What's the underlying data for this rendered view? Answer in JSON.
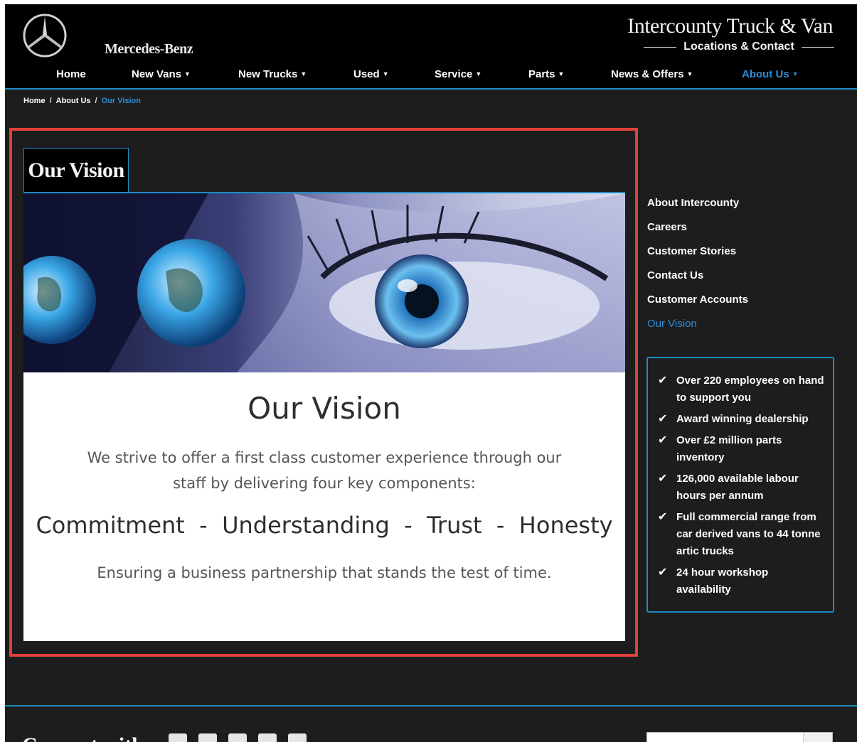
{
  "header": {
    "brand_name": "Mercedes-Benz",
    "dealer_title": "Intercounty Truck & Van",
    "locations_link": "Locations & Contact"
  },
  "nav": {
    "items": [
      {
        "label": "Home",
        "has_dropdown": false
      },
      {
        "label": "New Vans",
        "has_dropdown": true
      },
      {
        "label": "New Trucks",
        "has_dropdown": true
      },
      {
        "label": "Used",
        "has_dropdown": true
      },
      {
        "label": "Service",
        "has_dropdown": true
      },
      {
        "label": "Parts",
        "has_dropdown": true
      },
      {
        "label": "News & Offers",
        "has_dropdown": true
      },
      {
        "label": "About Us",
        "has_dropdown": true,
        "active": true
      }
    ],
    "caret": "▼"
  },
  "breadcrumb": {
    "items": [
      "Home",
      "About Us",
      "Our Vision"
    ],
    "separator": "/"
  },
  "main": {
    "tab_title": "Our Vision",
    "heading": "Our Vision",
    "intro": "We strive to offer a first class customer experience through our staff by delivering four key components:",
    "values_line": "Commitment  -  Understanding  -  Trust  -  Honesty",
    "closing": "Ensuring a business partnership that stands the test of time."
  },
  "sidebar": {
    "links": [
      {
        "label": "About Intercounty"
      },
      {
        "label": "Careers"
      },
      {
        "label": "Customer Stories"
      },
      {
        "label": "Contact Us"
      },
      {
        "label": "Customer Accounts"
      },
      {
        "label": "Our Vision",
        "active": true
      }
    ],
    "facts": [
      "Over 220 employees on hand to support you",
      "Award winning dealership",
      "Over £2 million parts inventory",
      "126,000 available labour hours per annum",
      "Full commercial range from car derived vans to 44 tonne artic trucks",
      "24 hour workshop availability"
    ],
    "check_icon": "✔"
  },
  "footer": {
    "connect_label": "Connect with us"
  },
  "colors": {
    "accent": "#1e8bc3",
    "active_link": "#2b8fd8",
    "highlight_frame": "#e0413a",
    "page_bg": "#1d1d1d",
    "header_bg": "#000000"
  }
}
